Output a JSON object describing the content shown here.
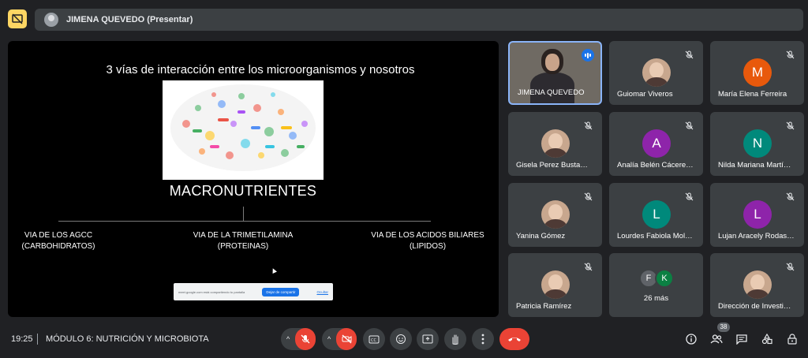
{
  "header": {
    "presenter_label": "JIMENA QUEVEDO (Presentar)"
  },
  "slide": {
    "title": "3 vías de interacción entre los microorganismos y nosotros",
    "center_label": "MACRONUTRIENTES",
    "vias": [
      {
        "line1": "VIA DE LOS AGCC",
        "line2": "(CARBOHIDRATOS)"
      },
      {
        "line1": "VIA DE LA TRIMETILAMINA",
        "line2": "(PROTEINAS)"
      },
      {
        "line1": "VIA DE LOS ACIDOS BILIARES",
        "line2": "(LIPIDOS)"
      }
    ],
    "share_bar": {
      "text": "meet.google.com está compartiendo tu pantalla",
      "stop_label": "Dejar de compartir",
      "hide_label": "Ocultar"
    }
  },
  "participants": [
    {
      "name": "JIMENA QUEVEDO",
      "initial": "",
      "color": "",
      "speaking": true
    },
    {
      "name": "Guiomar Viveros",
      "initial": "",
      "color": ""
    },
    {
      "name": "María Elena Ferreira",
      "initial": "M",
      "color": "#e8590c"
    },
    {
      "name": "Gisela Perez Busta…",
      "initial": "",
      "color": ""
    },
    {
      "name": "Analía Belén Cácere…",
      "initial": "A",
      "color": "#8e24aa"
    },
    {
      "name": "Nilda Mariana Martí…",
      "initial": "N",
      "color": "#00897b"
    },
    {
      "name": "Yanina Gómez",
      "initial": "",
      "color": ""
    },
    {
      "name": "Lourdes Fabiola Mol…",
      "initial": "L",
      "color": "#00897b"
    },
    {
      "name": "Lujan Aracely Rodas…",
      "initial": "L",
      "color": "#8e24aa"
    },
    {
      "name": "Patricia Ramírez",
      "initial": "",
      "color": ""
    },
    {
      "name": "Dirección de Investi…",
      "initial": "",
      "color": ""
    }
  ],
  "more": {
    "initials": [
      "F",
      "K"
    ],
    "colors": [
      "#5f6368",
      "#0b8043"
    ],
    "label": "26 más"
  },
  "footer": {
    "time": "19:25",
    "meeting_title": "MÓDULO 6: NUTRICIÓN Y MICROBIOTA",
    "participant_count": "38"
  },
  "colors": {
    "accent": "#1a73e8",
    "danger": "#ea4335",
    "tile": "#3c4043",
    "background": "#202124"
  }
}
